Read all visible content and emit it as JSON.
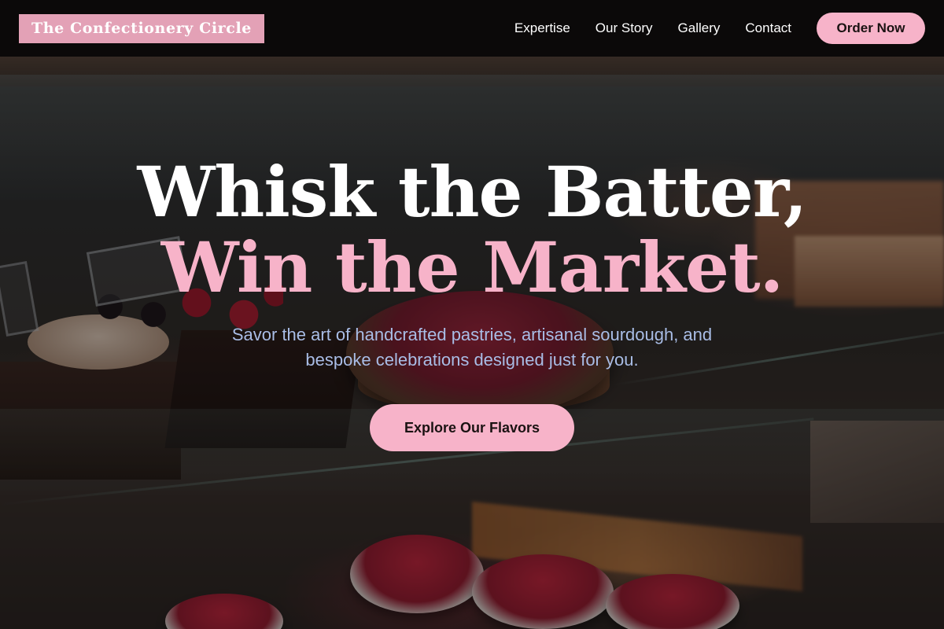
{
  "navbar": {
    "logo_text": "The Confectionery Circle",
    "links": [
      {
        "label": "Expertise"
      },
      {
        "label": "Our Story"
      },
      {
        "label": "Gallery"
      },
      {
        "label": "Contact"
      }
    ],
    "order_button": "Order Now"
  },
  "hero": {
    "headline_line1": "Whisk the Batter,",
    "headline_line2": "Win the Market.",
    "subtitle": "Savor the art of handcrafted pastries, artisanal sourdough, and bespoke celebrations designed just for you.",
    "cta_label": "Explore Our Flavors"
  },
  "colors": {
    "accent_pink": "#f7b3c9",
    "logo_pink": "#e3a1b6",
    "subtitle_blue": "#a9bde6",
    "navbar_bg": "#0a0808"
  }
}
